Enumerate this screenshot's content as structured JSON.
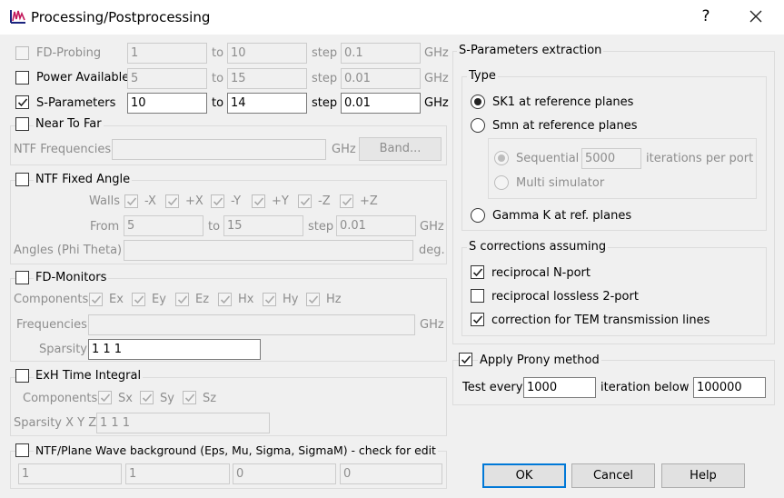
{
  "window": {
    "title": "Processing/Postprocessing",
    "help_glyph": "?",
    "icon": "app-icon",
    "close_icon": "close-icon"
  },
  "fd_probing": {
    "label": "FD-Probing",
    "checked": false,
    "from": "1",
    "to_label": "to",
    "to": "10",
    "step_label": "step",
    "step": "0.1",
    "unit": "GHz"
  },
  "power_available": {
    "label": "Power Available",
    "checked": false,
    "from": "5",
    "to_label": "to",
    "to": "15",
    "step_label": "step",
    "step": "0.01",
    "unit": "GHz"
  },
  "s_parameters": {
    "label": "S-Parameters",
    "checked": true,
    "from": "10",
    "to_label": "to",
    "to": "14",
    "step_label": "step",
    "step": "0.01",
    "unit": "GHz"
  },
  "near_to_far": {
    "label": "Near To Far",
    "checked": false,
    "freq_label": "NTF Frequencies",
    "freq_value": "",
    "unit": "GHz",
    "band_button": "Band..."
  },
  "ntf_fixed_angle": {
    "label": "NTF Fixed Angle",
    "checked": false,
    "walls_label": "Walls",
    "walls": [
      {
        "label": "-X",
        "checked": true
      },
      {
        "label": "+X",
        "checked": true
      },
      {
        "label": "-Y",
        "checked": true
      },
      {
        "label": "+Y",
        "checked": true
      },
      {
        "label": "-Z",
        "checked": true
      },
      {
        "label": "+Z",
        "checked": true
      }
    ],
    "from_label": "From",
    "from": "5",
    "to_label": "to",
    "to": "15",
    "step_label": "step",
    "step": "0.01",
    "unit": "GHz",
    "angles_label": "Angles (Phi Theta)",
    "angles_value": "",
    "angles_unit": "deg."
  },
  "fd_monitors": {
    "label": "FD-Monitors",
    "checked": false,
    "components_label": "Components",
    "components": [
      {
        "label": "Ex",
        "checked": true
      },
      {
        "label": "Ey",
        "checked": true
      },
      {
        "label": "Ez",
        "checked": true
      },
      {
        "label": "Hx",
        "checked": true
      },
      {
        "label": "Hy",
        "checked": true
      },
      {
        "label": "Hz",
        "checked": true
      }
    ],
    "frequencies_label": "Frequencies",
    "frequencies_value": "",
    "unit": "GHz",
    "sparsity_label": "Sparsity",
    "sparsity_value": "1 1 1"
  },
  "exh_time_integral": {
    "label": "ExH Time Integral",
    "checked": false,
    "components_label": "Components",
    "components": [
      {
        "label": "Sx",
        "checked": true
      },
      {
        "label": "Sy",
        "checked": true
      },
      {
        "label": "Sz",
        "checked": true
      }
    ],
    "sparsity_label": "Sparsity X Y Z",
    "sparsity_value": "1 1 1"
  },
  "ntf_plane_wave": {
    "label": "NTF/Plane Wave background (Eps, Mu, Sigma, SigmaM) - check for edit",
    "checked": false,
    "values": [
      "1",
      "1",
      "0",
      "0"
    ]
  },
  "s_extraction": {
    "title": "S-Parameters extraction",
    "type_title": "Type",
    "sk1": {
      "label": "SK1 at reference planes",
      "selected": true
    },
    "smn": {
      "label": "Smn at reference planes",
      "selected": false
    },
    "sequential": {
      "label": "Sequential",
      "selected": true,
      "value": "5000",
      "suffix": "iterations per port"
    },
    "multi": {
      "label": "Multi simulator",
      "selected": false
    },
    "gamma": {
      "label": "Gamma K at ref. planes",
      "selected": false
    },
    "corrections_title": "S corrections assuming",
    "corrections": [
      {
        "label": "reciprocal N-port",
        "checked": true
      },
      {
        "label": "reciprocal lossless 2-port",
        "checked": false
      },
      {
        "label": "correction for TEM transmission lines",
        "checked": true
      }
    ]
  },
  "prony": {
    "label": "Apply Prony method",
    "checked": true,
    "test_label": "Test every",
    "test_value": "1000",
    "iteration_label": "iteration",
    "below_label": "below",
    "below_value": "100000"
  },
  "buttons": {
    "ok": "OK",
    "cancel": "Cancel",
    "help": "Help"
  }
}
